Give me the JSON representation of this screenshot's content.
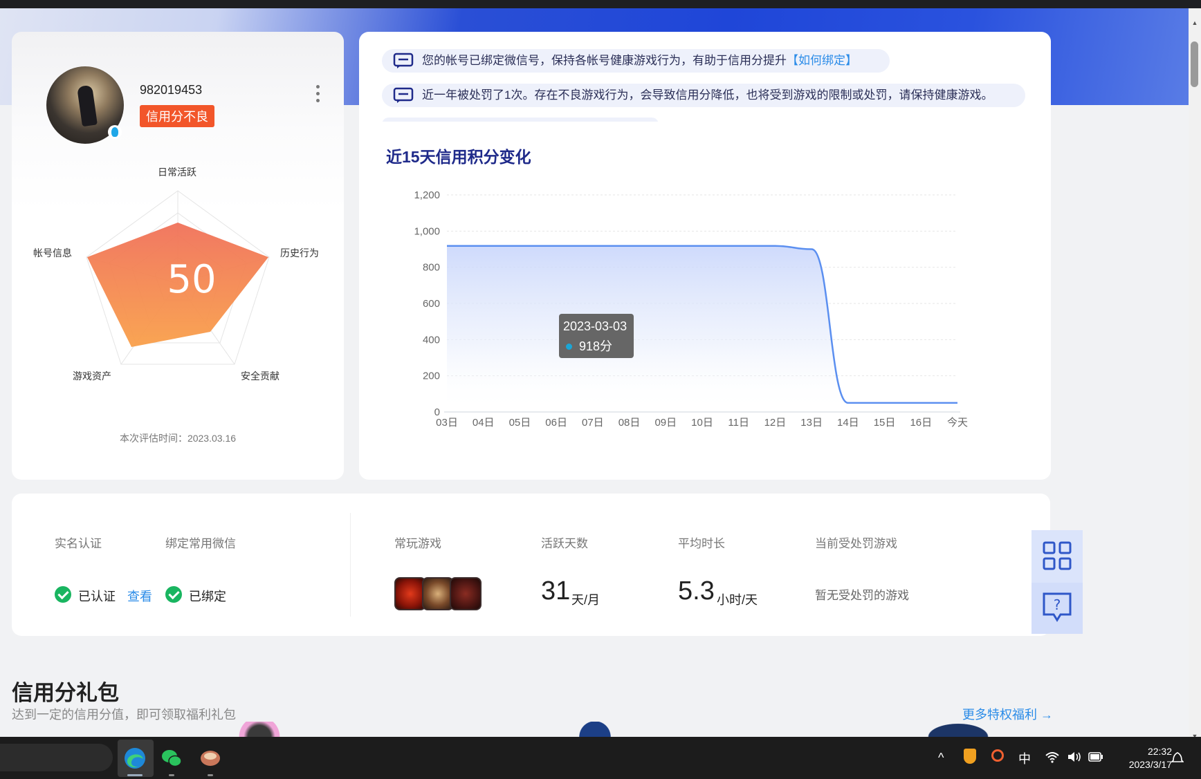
{
  "profile": {
    "username": "982019453",
    "status_tag": "信用分不良",
    "score": "50",
    "radar_labels": {
      "top": "日常活跃",
      "right": "历史行为",
      "bottom_right": "安全贡献",
      "bottom_left": "游戏资产",
      "left": "帐号信息"
    },
    "eval_time": "本次评估时间：2023.03.16"
  },
  "notices": [
    {
      "text": "您的帐号已绑定微信号，保持各帐号健康游戏行为，有助于信用分提升",
      "link": "【如何绑定】"
    },
    {
      "text": "近一年被处罚了1次。存在不良游戏行为，会导致信用分降低，也将受到游戏的限制或处罚，请保持健康游戏。",
      "link": ""
    }
  ],
  "chart_title": "近15天信用积分变化",
  "chart_data": {
    "type": "area",
    "title": "近15天信用积分变化",
    "categories": [
      "03日",
      "04日",
      "05日",
      "06日",
      "07日",
      "08日",
      "09日",
      "10日",
      "11日",
      "12日",
      "13日",
      "14日",
      "15日",
      "16日",
      "今天"
    ],
    "series": [
      {
        "values": [
          918,
          918,
          918,
          918,
          918,
          918,
          918,
          918,
          918,
          918,
          900,
          50,
          50,
          50,
          50
        ]
      }
    ],
    "ylim": [
      0,
      1200
    ],
    "yticks": [
      "0",
      "200",
      "400",
      "600",
      "800",
      "1,000",
      "1,200"
    ],
    "grid": true,
    "tooltip": {
      "date": "2023-03-03",
      "value": "918分"
    },
    "color": "#5b8ff0"
  },
  "stats": {
    "real_name": {
      "label": "实名认证",
      "value": "已认证",
      "link": "查看"
    },
    "wechat": {
      "label": "绑定常用微信",
      "value": "已绑定"
    },
    "games": {
      "label": "常玩游戏",
      "icons": [
        "cf-game-icon",
        "wuxia-game-icon",
        "lol-game-icon"
      ]
    },
    "active_days": {
      "label": "活跃天数",
      "number": "31",
      "unit": "天/月"
    },
    "avg_time": {
      "label": "平均时长",
      "number": "5.3",
      "unit": "小时/天"
    },
    "penalty": {
      "label": "当前受处罚游戏",
      "value": "暂无受处罚的游戏"
    }
  },
  "gift_section": {
    "title": "信用分礼包",
    "subtitle": "达到一定的信用分值，即可领取福利礼包",
    "more": "更多特权福利 →"
  },
  "taskbar": {
    "ime": "中",
    "time": "22:32",
    "date": "2023/3/17"
  },
  "colors": {
    "accent": "#2b8ce8",
    "warning": "#f2562a",
    "radar_fill_top": "#f0715a",
    "radar_fill_bottom": "#f9a04a",
    "success": "#19b560"
  }
}
